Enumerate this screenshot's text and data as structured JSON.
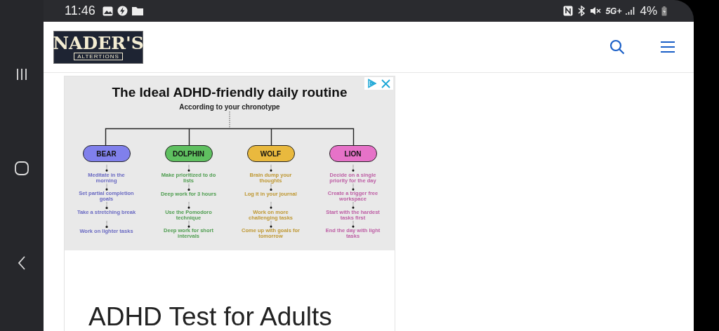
{
  "status_bar": {
    "time": "11:46",
    "network": "5G+",
    "battery": "4%"
  },
  "header": {
    "logo": {
      "name": "NADER'S",
      "tagline": "ALTERTIONS"
    }
  },
  "ad": {
    "title": "The Ideal ADHD-friendly daily routine",
    "subtitle": "According to your chronotype",
    "columns": [
      {
        "name": "BEAR",
        "color": "#8080ec",
        "tasks": [
          "Meditate in the morning",
          "Set partial completion goals",
          "Take a stretching break",
          "Work on lighter tasks"
        ]
      },
      {
        "name": "DOLPHIN",
        "color": "#5fc060",
        "tasks": [
          "Make prioritized to do lists",
          "Deep work for 3 hours",
          "Use the Pomodoro technique",
          "Deep work for short intervals"
        ]
      },
      {
        "name": "WOLF",
        "color": "#e9b93e",
        "tasks": [
          "Brain dump your thoughts",
          "Log it in your journal",
          "Work on more challenging tasks",
          "Come up with goals for tomorrow"
        ]
      },
      {
        "name": "LION",
        "color": "#e672c8",
        "tasks": [
          "Decide on a single priority for the day",
          "Create a trigger free workspace",
          "Start with the hardest tasks first",
          "End the day with light tasks"
        ]
      }
    ]
  },
  "article": {
    "heading": "ADHD Test for Adults"
  }
}
